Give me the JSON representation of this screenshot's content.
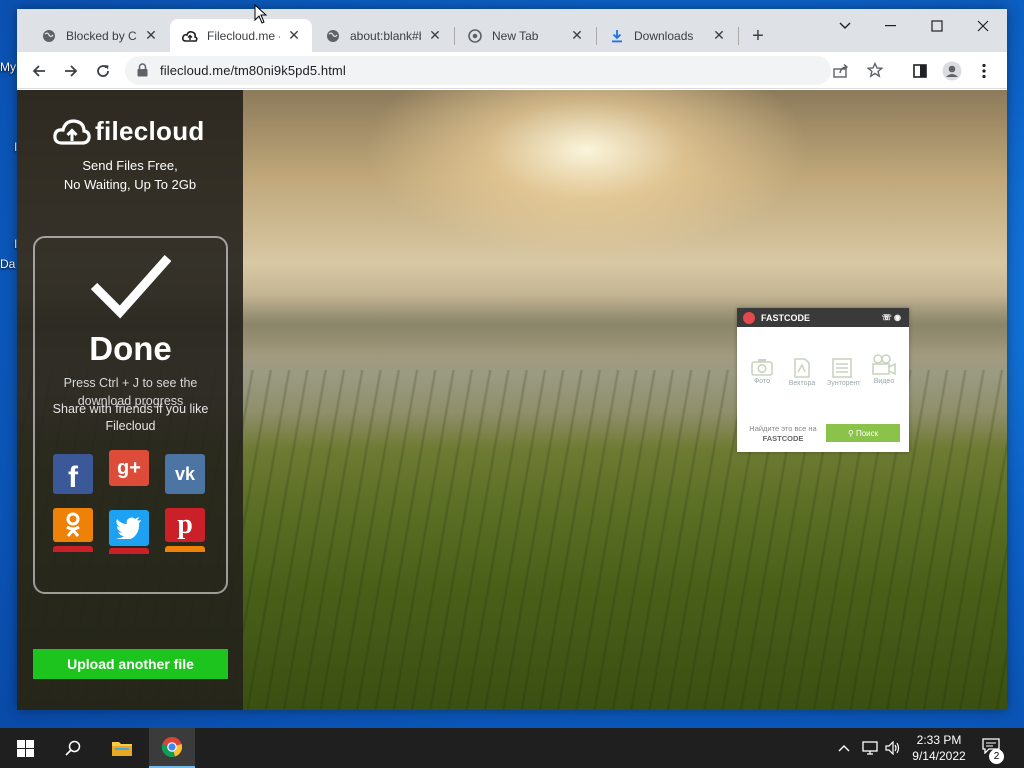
{
  "desktop": {
    "labels": [
      "My",
      "Da"
    ]
  },
  "browser": {
    "tabs": [
      {
        "title": "Blocked by Clo",
        "icon": "globe-icon",
        "active": false
      },
      {
        "title": "Filecloud.me -",
        "icon": "filecloud-cloud-icon",
        "active": true
      },
      {
        "title": "about:blank#b",
        "icon": "globe-icon",
        "active": false
      },
      {
        "title": "New Tab",
        "icon": "chrome-icon",
        "active": false
      },
      {
        "title": "Downloads",
        "icon": "download-icon",
        "active": false
      }
    ],
    "url": "filecloud.me/tm80ni9k5pd5.html"
  },
  "page": {
    "logo_text": "filecloud",
    "tagline_1": "Send Files Free,",
    "tagline_2": "No Waiting, Up To 2Gb",
    "done_title": "Done",
    "done_hint": "Press Ctrl + J to see the download progress",
    "share_text": "Share with friends if you like Filecloud",
    "upload_button": "Upload another file",
    "social": [
      {
        "name": "facebook",
        "color": "#3b5998",
        "glyph": "f"
      },
      {
        "name": "google-plus",
        "color": "#dd4b39",
        "glyph": "g+"
      },
      {
        "name": "vk",
        "color": "#4c75a3",
        "glyph": "vk"
      },
      {
        "name": "odnoklassniki",
        "color": "#ee8208",
        "glyph": "ok"
      },
      {
        "name": "twitter",
        "color": "#1da1f2",
        "glyph": "t"
      },
      {
        "name": "pinterest",
        "color": "#cb2027",
        "glyph": "p"
      }
    ]
  },
  "fastcode": {
    "title": "FASTCODE",
    "icons": [
      "Фото",
      "Вектора",
      "Зунторент",
      "Видео"
    ],
    "find_line1": "Найдите это все на",
    "find_line2": "FASTCODE",
    "search_button": "Поиск"
  },
  "taskbar": {
    "time": "2:33 PM",
    "date": "9/14/2022",
    "notification_count": "2"
  }
}
